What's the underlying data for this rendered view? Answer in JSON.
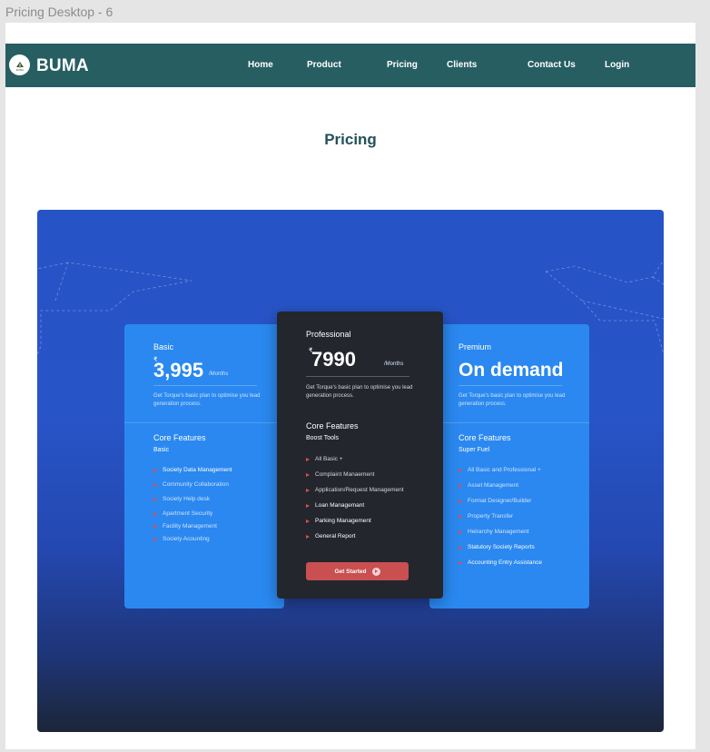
{
  "frame_label": "Pricing Desktop - 6",
  "nav": {
    "brand": "BUMA",
    "logo_text": "BUMA",
    "links": [
      "Home",
      "Product",
      "Pricing",
      "Clients",
      "Contact Us",
      "Login"
    ]
  },
  "page_title": "Pricing",
  "plans": {
    "basic": {
      "name": "Basic",
      "currency": "₹",
      "price": "3,995",
      "per": "/Months",
      "desc": "Get Torque's basic plan to optimise you lead generation process.",
      "core": "Core Features",
      "sub": "Basic",
      "features": [
        "Society Data Management",
        "Community Collaboration",
        "Society Help desk",
        "Apartment Security",
        "Facility Management",
        "Society  Acounting"
      ]
    },
    "professional": {
      "name": "Professional",
      "currency": "₹",
      "price": "7990",
      "per": "/Months",
      "desc": "Get Torque's basic plan to optimise you lead generation process.",
      "core": "Core Features",
      "sub": "Boost Tools",
      "features": [
        "All Basic +",
        "Complaint Manaement",
        "Application/Request Management",
        "Loan Managemant",
        "Parking Management",
        "General Report"
      ],
      "cta": "Get Started"
    },
    "premium": {
      "name": "Premium",
      "price": "On demand",
      "desc": "Get Torque's basic plan to optimise you lead generation process.",
      "core": "Core Features",
      "sub": "Super Fuel",
      "features": [
        "All Basic and Professional +",
        "Asset Management",
        "Format Designer/Builder",
        "Property Transfer",
        "Heirarchy Management",
        "Statutory Society Reports",
        "Accounting Entry Assistance"
      ]
    }
  },
  "colors": {
    "navbar": "#275e62",
    "title": "#23525a",
    "card_blue": "#2a88f0",
    "card_dark": "#23262d",
    "accent_red": "#c94f50",
    "hero_top": "#2654c6",
    "hero_bottom": "#1c2638"
  }
}
